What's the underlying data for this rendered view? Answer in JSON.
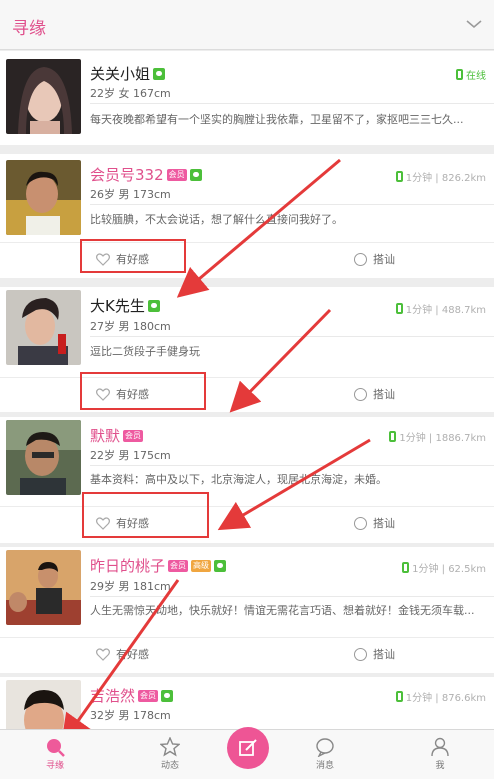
{
  "header": {
    "title": "寻缘"
  },
  "members": [
    {
      "name": "关关小姐",
      "badges": [],
      "meta": "22岁 女 167cm",
      "status": "在线",
      "bio": "每天夜晚都希望有一个坚实的胸膛让我依靠，卫星留不了，家抠吧三三七久...",
      "like_label": "",
      "chat_label": ""
    },
    {
      "name": "会员号332",
      "badges": [
        "会员"
      ],
      "meta": "26岁 男 173cm",
      "status": "1分钟 | 826.2km",
      "bio": "比较腼腆，不太会说话，想了解什么直接问我好了。",
      "like_label": "有好感",
      "chat_label": "搭讪"
    },
    {
      "name": "大K先生",
      "badges": [],
      "meta": "27岁 男 180cm",
      "status": "1分钟 | 488.7km",
      "bio": "逗比二货段子手健身玩",
      "like_label": "有好感",
      "chat_label": "搭讪"
    },
    {
      "name": "默默",
      "badges": [
        "会员"
      ],
      "meta": "22岁 男 175cm",
      "status": "1分钟 | 1886.7km",
      "bio": "基本资料：高中及以下，北京海淀人，现居北京海淀，未婚。",
      "like_label": "有好感",
      "chat_label": "搭讪"
    },
    {
      "name": "昨日的桃子",
      "badges": [
        "会员",
        "高级"
      ],
      "meta": "29岁 男 181cm",
      "status": "1分钟 | 62.5km",
      "bio": "人生无需惊天动地，快乐就好！情谊无需花言巧语、想着就好！金钱无须车载...",
      "like_label": "有好感",
      "chat_label": "搭讪"
    },
    {
      "name": "吉浩然",
      "badges": [
        "会员"
      ],
      "meta": "32岁 男 178cm",
      "status": "1分钟 | 876.6km",
      "bio": "",
      "like_label": "",
      "chat_label": ""
    }
  ],
  "tabbar": {
    "items": [
      {
        "label": "寻缘",
        "icon": "search-heart-icon",
        "active": true
      },
      {
        "label": "动态",
        "icon": "star-icon",
        "active": false
      },
      {
        "label": "",
        "icon": "compose-icon",
        "active": false
      },
      {
        "label": "消息",
        "icon": "chat-bubble-icon",
        "active": false
      },
      {
        "label": "我",
        "icon": "user-icon",
        "active": false
      }
    ]
  },
  "colors": {
    "accent": "#e0508c",
    "online": "#4cbf3a",
    "highlight": "#e43a3a"
  }
}
